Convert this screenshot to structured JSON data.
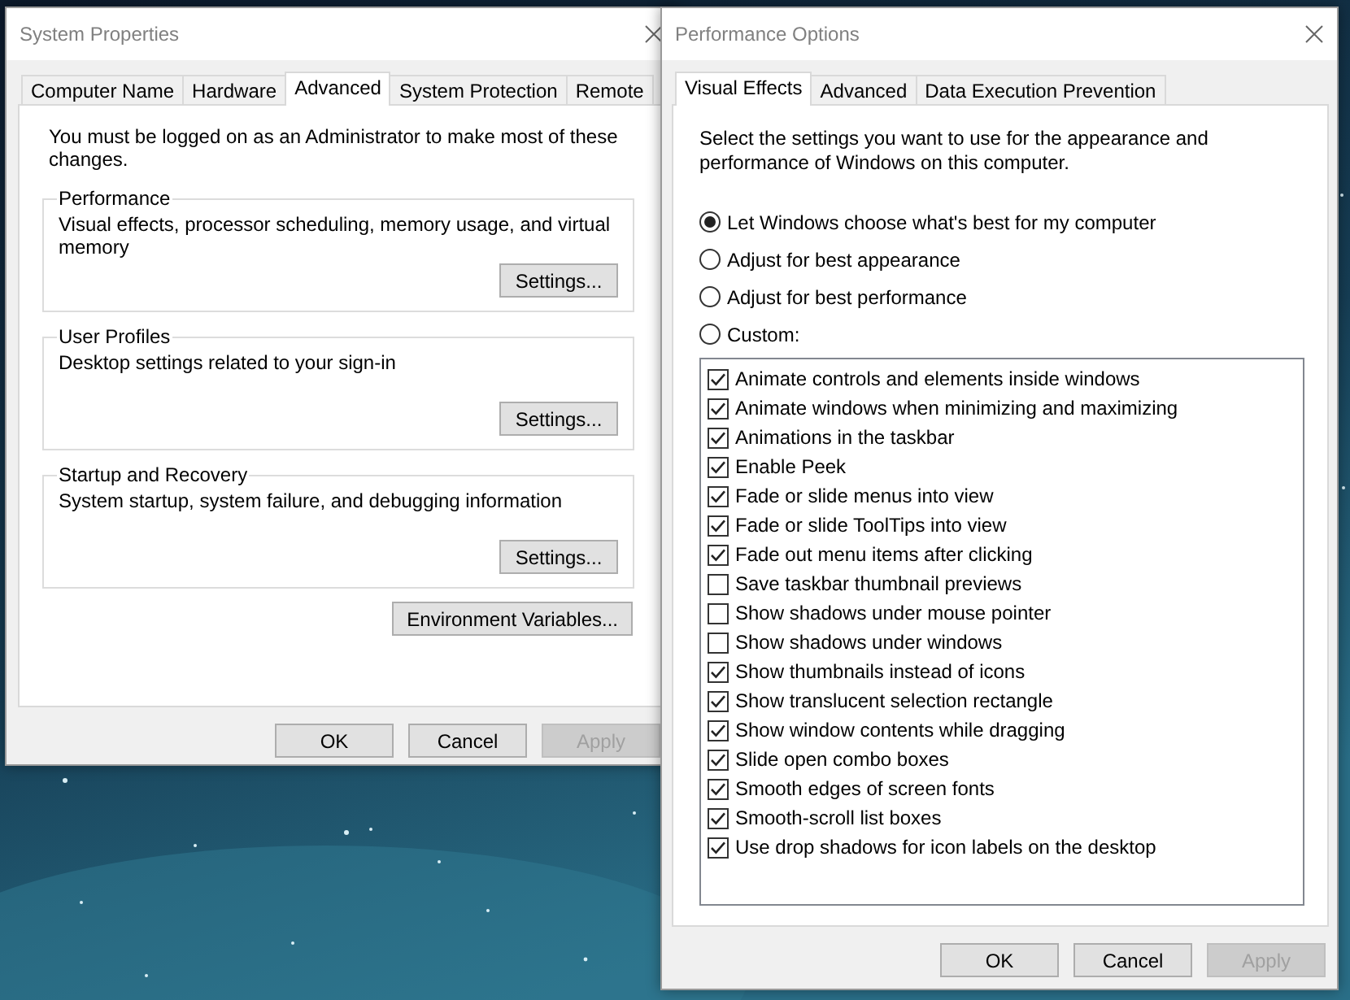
{
  "system_properties": {
    "title": "System Properties",
    "tabs": [
      {
        "label": "Computer Name",
        "selected": false
      },
      {
        "label": "Hardware",
        "selected": false
      },
      {
        "label": "Advanced",
        "selected": true
      },
      {
        "label": "System Protection",
        "selected": false
      },
      {
        "label": "Remote",
        "selected": false
      }
    ],
    "notice": "You must be logged on as an Administrator to make most of these changes.",
    "groups": [
      {
        "title": "Performance",
        "description": "Visual effects, processor scheduling, memory usage, and virtual memory",
        "button": "Settings..."
      },
      {
        "title": "User Profiles",
        "description": "Desktop settings related to your sign-in",
        "button": "Settings..."
      },
      {
        "title": "Startup and Recovery",
        "description": "System startup, system failure, and debugging information",
        "button": "Settings..."
      }
    ],
    "env_button": "Environment Variables...",
    "buttons": [
      {
        "label": "OK",
        "disabled": false
      },
      {
        "label": "Cancel",
        "disabled": false
      },
      {
        "label": "Apply",
        "disabled": true
      }
    ]
  },
  "performance_options": {
    "title": "Performance Options",
    "tabs": [
      {
        "label": "Visual Effects",
        "selected": true
      },
      {
        "label": "Advanced",
        "selected": false
      },
      {
        "label": "Data Execution Prevention",
        "selected": false
      }
    ],
    "intro": "Select the settings you want to use for the appearance and performance of Windows on this computer.",
    "options": [
      {
        "label": "Let Windows choose what's best for my computer",
        "selected": true
      },
      {
        "label": "Adjust for best appearance",
        "selected": false
      },
      {
        "label": "Adjust for best performance",
        "selected": false
      },
      {
        "label": "Custom:",
        "selected": false
      }
    ],
    "effects": [
      {
        "label": "Animate controls and elements inside windows",
        "checked": true
      },
      {
        "label": "Animate windows when minimizing and maximizing",
        "checked": true
      },
      {
        "label": "Animations in the taskbar",
        "checked": true
      },
      {
        "label": "Enable Peek",
        "checked": true
      },
      {
        "label": "Fade or slide menus into view",
        "checked": true
      },
      {
        "label": "Fade or slide ToolTips into view",
        "checked": true
      },
      {
        "label": "Fade out menu items after clicking",
        "checked": true
      },
      {
        "label": "Save taskbar thumbnail previews",
        "checked": false
      },
      {
        "label": "Show shadows under mouse pointer",
        "checked": false
      },
      {
        "label": "Show shadows under windows",
        "checked": false
      },
      {
        "label": "Show thumbnails instead of icons",
        "checked": true
      },
      {
        "label": "Show translucent selection rectangle",
        "checked": true
      },
      {
        "label": "Show window contents while dragging",
        "checked": true
      },
      {
        "label": "Slide open combo boxes",
        "checked": true
      },
      {
        "label": "Smooth edges of screen fonts",
        "checked": true
      },
      {
        "label": "Smooth-scroll list boxes",
        "checked": true
      },
      {
        "label": "Use drop shadows for icon labels on the desktop",
        "checked": true
      }
    ],
    "buttons": [
      {
        "label": "OK",
        "disabled": false
      },
      {
        "label": "Cancel",
        "disabled": false
      },
      {
        "label": "Apply",
        "disabled": true
      }
    ]
  }
}
